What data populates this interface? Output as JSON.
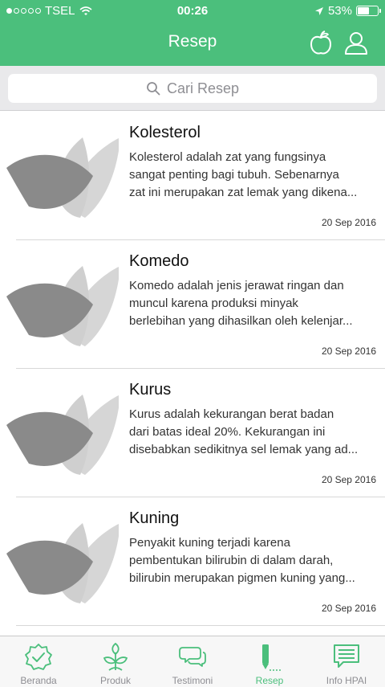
{
  "status_bar": {
    "carrier": "TSEL",
    "time": "00:26",
    "battery_percent": "53%",
    "battery_level": 0.53
  },
  "header": {
    "title": "Resep",
    "icons": [
      "apple-icon",
      "user-icon"
    ]
  },
  "search": {
    "placeholder": "Cari Resep"
  },
  "recipes": [
    {
      "title": "Kolesterol",
      "desc": [
        "Kolesterol adalah zat yang fungsinya",
        "sangat penting bagi tubuh. Sebenarnya",
        "zat ini merupakan zat lemak yang dikena..."
      ],
      "date": "20 Sep 2016"
    },
    {
      "title": "Komedo",
      "desc": [
        "Komedo adalah jenis jerawat ringan dan",
        "muncul karena produksi minyak",
        "berlebihan yang dihasilkan oleh kelenjar..."
      ],
      "date": "20 Sep 2016"
    },
    {
      "title": "Kurus",
      "desc": [
        "Kurus adalah kekurangan berat badan",
        "dari batas ideal 20%. Kekurangan ini",
        "disebabkan sedikitnya sel lemak yang ad..."
      ],
      "date": "20 Sep 2016"
    },
    {
      "title": "Kuning",
      "desc": [
        "Penyakit kuning terjadi karena",
        "pembentukan bilirubin di dalam darah,",
        "bilirubin merupakan pigmen kuning yang..."
      ],
      "date": "20 Sep 2016"
    }
  ],
  "tabs": [
    {
      "label": "Beranda",
      "icon": "badge-check-icon"
    },
    {
      "label": "Produk",
      "icon": "plant-icon"
    },
    {
      "label": "Testimoni",
      "icon": "chat-bubbles-icon"
    },
    {
      "label": "Resep",
      "icon": "pen-icon",
      "active": true
    },
    {
      "label": "Info HPAI",
      "icon": "message-icon"
    }
  ],
  "colors": {
    "accent": "#4bbf7c",
    "inactive": "#8e8e93",
    "leaf_dark": "#8a8a8a",
    "leaf_light": "#d6d6d6"
  }
}
